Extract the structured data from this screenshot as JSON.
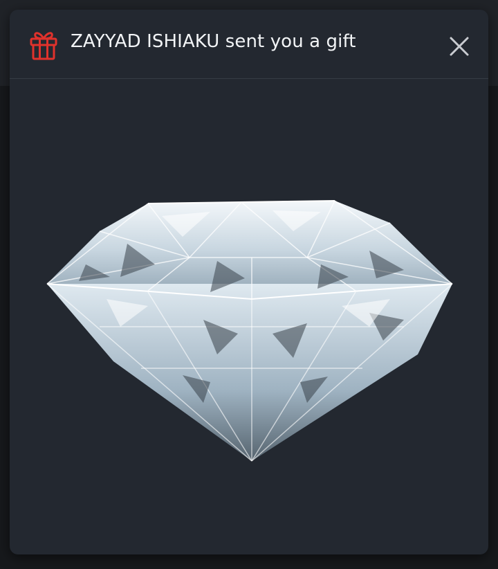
{
  "modal": {
    "title": "ZAYYAD ISHIAKU sent you a gift",
    "icon": "gift-icon",
    "close_icon": "close-icon",
    "image": "diamond-gift-image"
  },
  "colors": {
    "modal_bg": "#232830",
    "title_text": "#f2f4f6",
    "gift_icon": "#e0322c",
    "close_icon": "#c9ccd1"
  }
}
